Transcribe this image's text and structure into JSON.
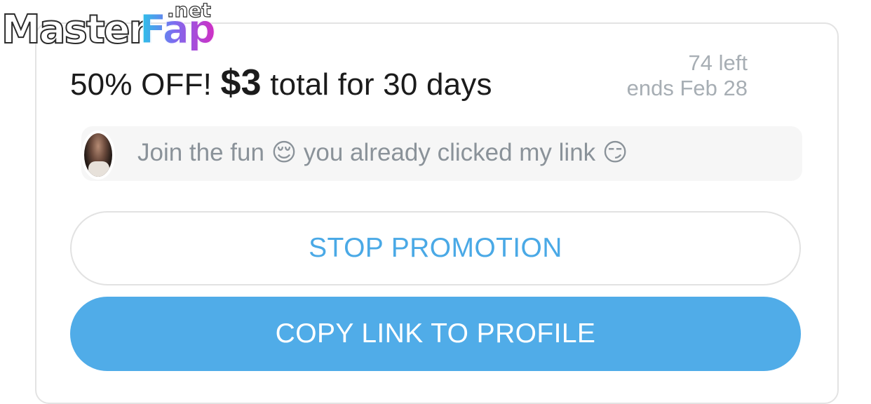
{
  "watermark": {
    "master": "Master",
    "fap": "Fap",
    "net": ".net"
  },
  "promotion": {
    "title_prefix": "50% OFF!",
    "title_price": "$3",
    "title_suffix": "total for 30 days",
    "remaining": "74 left",
    "ends": "ends Feb 28",
    "message": "Join the fun 😌 you already clicked my link 😏"
  },
  "buttons": {
    "stop_label": "STOP PROMOTION",
    "copy_label": "COPY LINK TO PROFILE"
  },
  "colors": {
    "accent": "#50ace8",
    "link_text": "#4aa9e6",
    "muted_text": "#a7aeb4"
  }
}
